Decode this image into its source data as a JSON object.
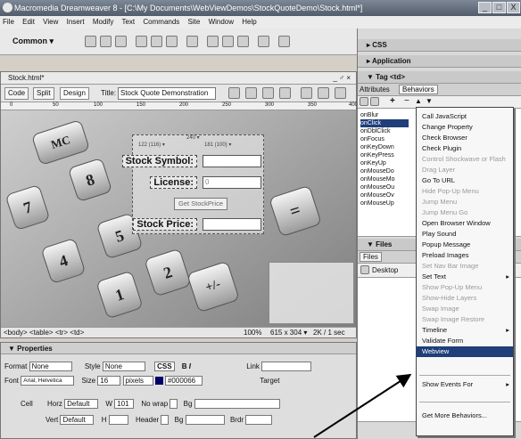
{
  "window": {
    "title": "Macromedia Dreamweaver 8 - [C:\\My Documents\\WebViewDemos\\StockQuoteDemo\\Stock.html*]",
    "controls": [
      "_",
      "□",
      "X"
    ]
  },
  "menubar": [
    "File",
    "Edit",
    "View",
    "Insert",
    "Modify",
    "Text",
    "Commands",
    "Site",
    "Window",
    "Help"
  ],
  "insertbar": {
    "category": "Common ▾"
  },
  "document": {
    "tab": "Stock.html*",
    "tab_controls": "_ ♂ ×",
    "view_buttons": [
      "Code",
      "Split",
      "Design"
    ],
    "title_label": "Title:",
    "title_value": "Stock Quote Demonstration",
    "ruler": [
      "0",
      "50",
      "100",
      "150",
      "200",
      "250",
      "300",
      "350",
      "400"
    ],
    "form": {
      "width_marker": "240 ▾",
      "col_markers": [
        "122 (116) ▾",
        "181 (100) ▾"
      ],
      "symbol_label": "Stock Symbol:",
      "license_label": "License:",
      "license_value": "0",
      "button_label": "Get StockPrice",
      "price_label": "Stock Price:"
    },
    "calculator_keys": [
      "MC",
      "8",
      "7",
      "4",
      "5",
      "1",
      "2",
      "=",
      "+/-"
    ],
    "status": {
      "path": "<body> <table> <tr> <td>",
      "zoom": "100%",
      "size": "615 x 304 ▾",
      "download": "2K / 1 sec"
    }
  },
  "properties": {
    "header": "▼ Properties",
    "format_label": "Format",
    "format_value": "None",
    "style_label": "Style",
    "style_value": "None",
    "css_button": "CSS",
    "bold": "B",
    "italic": "I",
    "link_label": "Link",
    "font_label": "Font",
    "font_value": "Arial, Helvetica",
    "size_label": "Size",
    "size_value": "16",
    "unit_value": "pixels",
    "color_value": "#000066",
    "target_label": "Target",
    "cell_label": "Cell",
    "horz_label": "Horz",
    "horz_value": "Default",
    "w_label": "W",
    "w_value": "101",
    "nowrap_label": "No wrap",
    "bg_label": "Bg",
    "vert_label": "Vert",
    "vert_value": "Default",
    "h_label": "H",
    "header_label": "Header",
    "brdr_label": "Brdr"
  },
  "panels": {
    "css": "▸ CSS",
    "application": "▸ Application",
    "tag": "▼ Tag <td>",
    "tabs": [
      "Attributes",
      "Behaviors"
    ],
    "behavior_tools": [
      "+",
      "−",
      "▲",
      "▼"
    ],
    "events": [
      "onBlur",
      "onClick",
      "onDblClick",
      "onFocus",
      "onKeyDown",
      "onKeyPress",
      "onKeyUp",
      "onMouseDo",
      "onMouseMo",
      "onMouseOu",
      "onMouseOv",
      "onMouseUp"
    ],
    "files": "▼ Files",
    "files_tab": "Files",
    "desktop": "Desktop"
  },
  "context_menu": {
    "items": [
      {
        "label": "Call JavaScript",
        "enabled": true
      },
      {
        "label": "Change Property",
        "enabled": true
      },
      {
        "label": "Check Browser",
        "enabled": true
      },
      {
        "label": "Check Plugin",
        "enabled": true
      },
      {
        "label": "Control Shockwave or Flash",
        "enabled": false
      },
      {
        "label": "Drag Layer",
        "enabled": false
      },
      {
        "label": "Go To URL",
        "enabled": true
      },
      {
        "label": "Hide Pop-Up Menu",
        "enabled": false
      },
      {
        "label": "Jump Menu",
        "enabled": false
      },
      {
        "label": "Jump Menu Go",
        "enabled": false
      },
      {
        "label": "Open Browser Window",
        "enabled": true
      },
      {
        "label": "Play Sound",
        "enabled": true
      },
      {
        "label": "Popup Message",
        "enabled": true
      },
      {
        "label": "Preload Images",
        "enabled": true
      },
      {
        "label": "Set Nav Bar Image",
        "enabled": false
      },
      {
        "label": "Set Text",
        "enabled": true,
        "submenu": true
      },
      {
        "label": "Show Pop-Up Menu",
        "enabled": false
      },
      {
        "label": "Show-Hide Layers",
        "enabled": false
      },
      {
        "label": "Swap Image",
        "enabled": false
      },
      {
        "label": "Swap Image Restore",
        "enabled": false
      },
      {
        "label": "Timeline",
        "enabled": true,
        "submenu": true
      },
      {
        "label": "Validate Form",
        "enabled": true
      },
      {
        "label": "Webview",
        "enabled": true,
        "selected": true
      }
    ],
    "show_events": "Show Events For",
    "more": "Get More Behaviors..."
  },
  "colors": {
    "menu_highlight": "#1f3e7a",
    "titlebar": "#5e6878"
  }
}
